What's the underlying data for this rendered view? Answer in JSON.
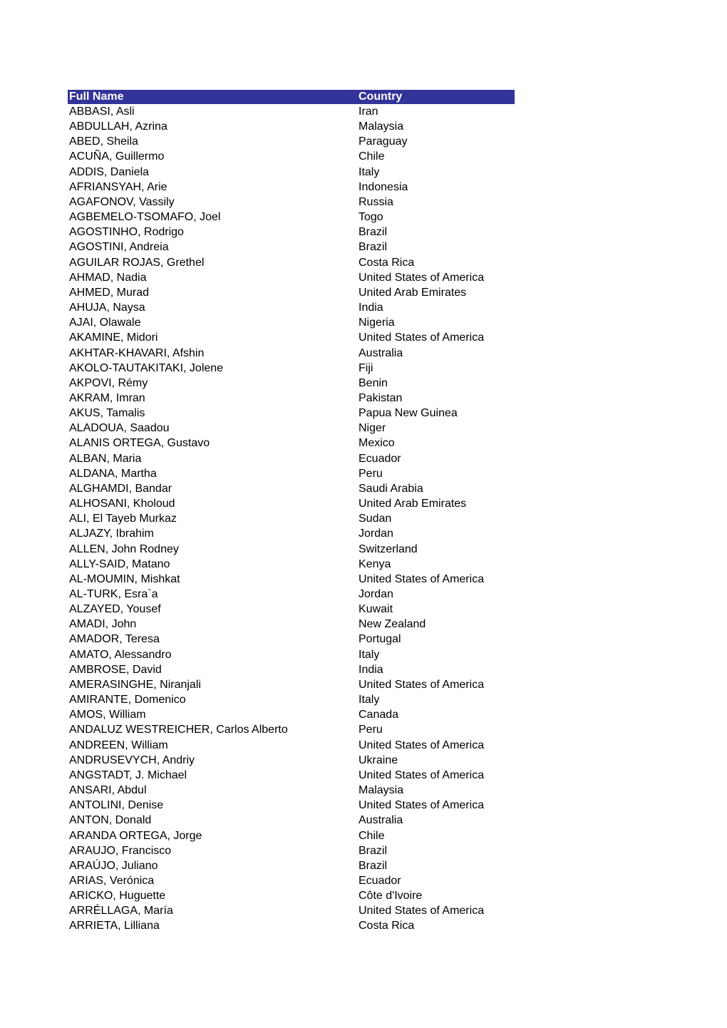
{
  "table": {
    "headers": {
      "name": "Full Name",
      "country": "Country"
    },
    "header_color": "#333399",
    "rows": [
      {
        "name": "ABBASI, Asli",
        "country": "Iran"
      },
      {
        "name": "ABDULLAH, Azrina",
        "country": "Malaysia"
      },
      {
        "name": "ABED, Sheila",
        "country": "Paraguay"
      },
      {
        "name": "ACUÑA, Guillermo",
        "country": "Chile"
      },
      {
        "name": "ADDIS, Daniela",
        "country": "Italy"
      },
      {
        "name": "AFRIANSYAH, Arie",
        "country": "Indonesia"
      },
      {
        "name": "AGAFONOV, Vassily",
        "country": "Russia"
      },
      {
        "name": "AGBEMELO-TSOMAFO, Joel",
        "country": "Togo"
      },
      {
        "name": "AGOSTINHO, Rodrigo",
        "country": "Brazil"
      },
      {
        "name": "AGOSTINI, Andreia",
        "country": "Brazil"
      },
      {
        "name": "AGUILAR ROJAS, Grethel",
        "country": "Costa Rica"
      },
      {
        "name": "AHMAD, Nadia",
        "country": "United States of America"
      },
      {
        "name": "AHMED, Murad",
        "country": "United Arab Emirates"
      },
      {
        "name": "AHUJA, Naysa",
        "country": "India"
      },
      {
        "name": "AJAI, Olawale",
        "country": "Nigeria"
      },
      {
        "name": "AKAMINE, Midori",
        "country": "United States of America"
      },
      {
        "name": "AKHTAR-KHAVARI, Afshin",
        "country": "Australia"
      },
      {
        "name": "AKOLO-TAUTAKITAKI, Jolene",
        "country": "Fiji"
      },
      {
        "name": "AKPOVI, Rémy",
        "country": "Benin"
      },
      {
        "name": "AKRAM, Imran",
        "country": "Pakistan"
      },
      {
        "name": "AKUS, Tamalis",
        "country": "Papua New Guinea"
      },
      {
        "name": "ALADOUA, Saadou",
        "country": "Niger"
      },
      {
        "name": "ALANIS ORTEGA, Gustavo",
        "country": "Mexico"
      },
      {
        "name": "ALBAN, Maria",
        "country": "Ecuador"
      },
      {
        "name": "ALDANA, Martha",
        "country": "Peru"
      },
      {
        "name": "ALGHAMDI, Bandar",
        "country": "Saudi Arabia"
      },
      {
        "name": "ALHOSANI, Kholoud",
        "country": "United Arab Emirates"
      },
      {
        "name": "ALI, El Tayeb Murkaz",
        "country": "Sudan"
      },
      {
        "name": "ALJAZY, Ibrahim",
        "country": "Jordan"
      },
      {
        "name": "ALLEN, John Rodney",
        "country": "Switzerland"
      },
      {
        "name": "ALLY-SAID, Matano",
        "country": "Kenya"
      },
      {
        "name": "AL-MOUMIN, Mishkat",
        "country": "United States of America"
      },
      {
        "name": "AL-TURK, Esra`a",
        "country": "Jordan"
      },
      {
        "name": "ALZAYED, Yousef",
        "country": "Kuwait"
      },
      {
        "name": "AMADI, John",
        "country": "New Zealand"
      },
      {
        "name": "AMADOR, Teresa",
        "country": "Portugal"
      },
      {
        "name": "AMATO, Alessandro",
        "country": "Italy"
      },
      {
        "name": "AMBROSE, David",
        "country": "India"
      },
      {
        "name": "AMERASINGHE, Niranjali",
        "country": "United States of America"
      },
      {
        "name": "AMIRANTE, Domenico",
        "country": "Italy"
      },
      {
        "name": "AMOS, William",
        "country": "Canada"
      },
      {
        "name": "ANDALUZ WESTREICHER, Carlos Alberto",
        "country": "Peru"
      },
      {
        "name": "ANDREEN, William",
        "country": "United States of America"
      },
      {
        "name": "ANDRUSEVYCH, Andriy",
        "country": "Ukraine"
      },
      {
        "name": "ANGSTADT, J. Michael",
        "country": "United States of America"
      },
      {
        "name": "ANSARI, Abdul",
        "country": "Malaysia"
      },
      {
        "name": "ANTOLINI, Denise",
        "country": "United States of America"
      },
      {
        "name": "ANTON, Donald",
        "country": "Australia"
      },
      {
        "name": "ARANDA ORTEGA, Jorge",
        "country": "Chile"
      },
      {
        "name": "ARAUJO, Francisco",
        "country": "Brazil"
      },
      {
        "name": "ARAÚJO, Juliano",
        "country": "Brazil"
      },
      {
        "name": "ARIAS, Verónica",
        "country": "Ecuador"
      },
      {
        "name": "ARICKO, Huguette",
        "country": "Côte d'Ivoire"
      },
      {
        "name": "ARRÉLLAGA, María",
        "country": "United States of America"
      },
      {
        "name": "ARRIETA, Lilliana",
        "country": "Costa Rica"
      }
    ]
  }
}
